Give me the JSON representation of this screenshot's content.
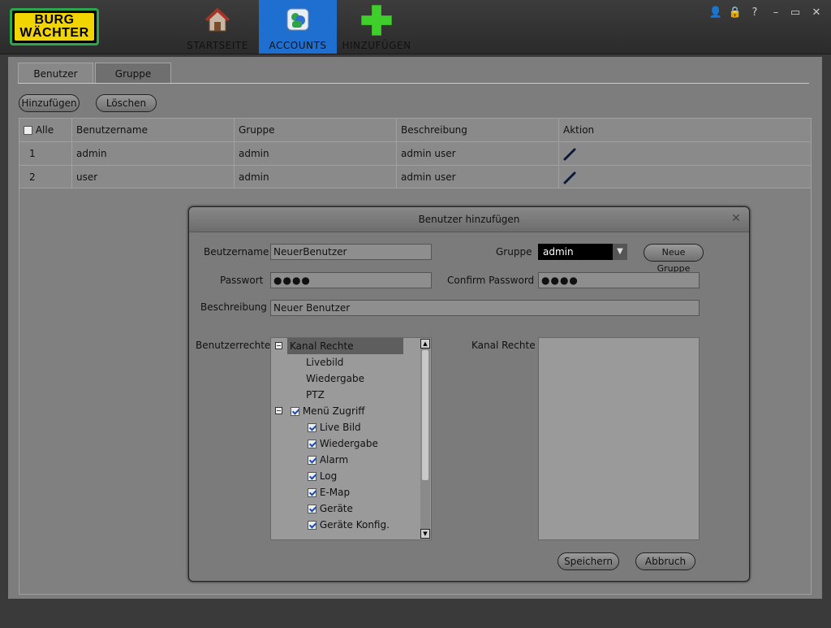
{
  "brand": {
    "line1": "BURG",
    "line2": "WÄCHTER"
  },
  "nav": [
    {
      "label": "STARTSEITE",
      "icon": "house-icon"
    },
    {
      "label": "ACCOUNTS",
      "icon": "accounts-icon"
    },
    {
      "label": "HINZUFÜGEN",
      "icon": "plus-icon"
    }
  ],
  "window_controls": {
    "user": "👤",
    "lock": "🔒",
    "help": "?",
    "minimize": "–",
    "maximize": "▭",
    "close": "✕"
  },
  "tabs": [
    {
      "label": "Benutzer"
    },
    {
      "label": "Gruppe"
    }
  ],
  "toolbar": {
    "add_label": "Hinzufügen",
    "delete_label": "Löschen"
  },
  "table": {
    "headers": [
      "Alle",
      "Benutzername",
      "Gruppe",
      "Beschreibung",
      "Aktion"
    ],
    "rows": [
      {
        "index": "1",
        "username": "admin",
        "group": "admin",
        "description": "admin user"
      },
      {
        "index": "2",
        "username": "user",
        "group": "admin",
        "description": "admin user"
      }
    ]
  },
  "dialog": {
    "title": "Benutzer hinzufügen",
    "username_label": "Beutzername",
    "username_value": "NeuerBenutzer",
    "group_label": "Gruppe",
    "group_value": "admin",
    "new_group_label": "Neue Gruppe",
    "password_label": "Passwort",
    "password_value": "●●●●",
    "confirm_label": "Confirm Password",
    "confirm_value": "●●●●",
    "description_label": "Beschreibung",
    "description_value": "Neuer Benutzer",
    "rights_label": "Benutzerrechte",
    "channel_rights_label": "Kanal Rechte",
    "tree": {
      "channel_root": "Kanal Rechte",
      "channel_items": [
        "Livebild",
        "Wiedergabe",
        "PTZ"
      ],
      "menu_root": "Menü Zugriff",
      "menu_items": [
        "Live Bild",
        "Wiedergabe",
        "Alarm",
        "Log",
        "E-Map",
        "Geräte",
        "Geräte Konfig."
      ]
    },
    "save_label": "Speichern",
    "cancel_label": "Abbruch"
  }
}
